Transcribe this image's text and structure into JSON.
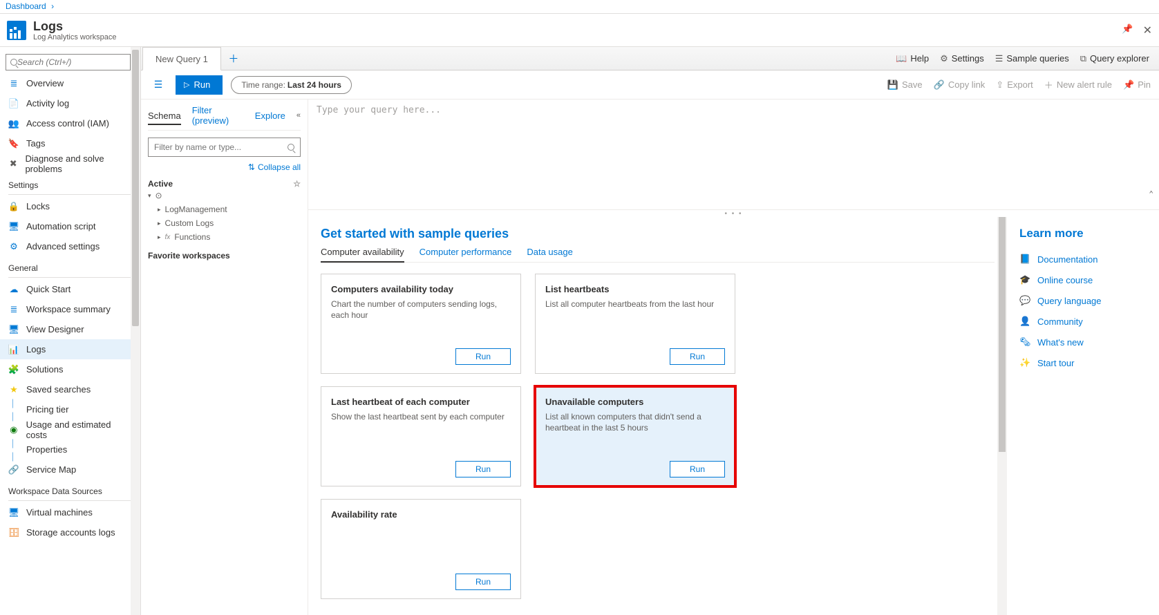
{
  "breadcrumb": {
    "root": "Dashboard"
  },
  "header": {
    "title": "Logs",
    "subtitle": "Log Analytics workspace"
  },
  "search": {
    "placeholder": "Search (Ctrl+/)"
  },
  "nav": {
    "top": [
      {
        "label": "Overview",
        "icon": "overview-icon"
      },
      {
        "label": "Activity log",
        "icon": "activity-icon"
      },
      {
        "label": "Access control (IAM)",
        "icon": "iam-icon"
      },
      {
        "label": "Tags",
        "icon": "tags-icon"
      },
      {
        "label": "Diagnose and solve problems",
        "icon": "diagnose-icon"
      }
    ],
    "sections": [
      {
        "title": "Settings",
        "items": [
          {
            "label": "Locks",
            "icon": "locks-icon"
          },
          {
            "label": "Automation script",
            "icon": "automation-icon"
          },
          {
            "label": "Advanced settings",
            "icon": "gear-icon"
          }
        ]
      },
      {
        "title": "General",
        "items": [
          {
            "label": "Quick Start",
            "icon": "quickstart-icon"
          },
          {
            "label": "Workspace summary",
            "icon": "summary-icon"
          },
          {
            "label": "View Designer",
            "icon": "viewdesigner-icon"
          },
          {
            "label": "Logs",
            "icon": "logs-icon",
            "active": true
          },
          {
            "label": "Solutions",
            "icon": "solutions-icon"
          },
          {
            "label": "Saved searches",
            "icon": "saved-icon"
          },
          {
            "label": "Pricing tier",
            "icon": "pricing-icon"
          },
          {
            "label": "Usage and estimated costs",
            "icon": "usage-icon"
          },
          {
            "label": "Properties",
            "icon": "properties-icon"
          },
          {
            "label": "Service Map",
            "icon": "servicemap-icon"
          }
        ]
      },
      {
        "title": "Workspace Data Sources",
        "items": [
          {
            "label": "Virtual machines",
            "icon": "vm-icon"
          },
          {
            "label": "Storage accounts logs",
            "icon": "storage-icon"
          }
        ]
      }
    ]
  },
  "tabs": {
    "query_tab": "New Query 1"
  },
  "tabs_right": [
    {
      "label": "Help",
      "icon": "book-icon"
    },
    {
      "label": "Settings",
      "icon": "gear-icon"
    },
    {
      "label": "Sample queries",
      "icon": "list-icon"
    },
    {
      "label": "Query explorer",
      "icon": "explorer-icon"
    }
  ],
  "toolbar": {
    "run": "Run",
    "time_label": "Time range:",
    "time_value": "Last 24 hours",
    "right": [
      {
        "label": "Save",
        "icon": "save-icon"
      },
      {
        "label": "Copy link",
        "icon": "link-icon"
      },
      {
        "label": "Export",
        "icon": "export-icon"
      },
      {
        "label": "New alert rule",
        "icon": "plus-icon"
      },
      {
        "label": "Pin",
        "icon": "pin-icon"
      }
    ]
  },
  "schema": {
    "tabs": {
      "schema": "Schema",
      "filter": "Filter (preview)",
      "explore": "Explore"
    },
    "filter_placeholder": "Filter by name or type...",
    "collapse_all": "Collapse all",
    "active_label": "Active",
    "tree": [
      {
        "label": "LogManagement"
      },
      {
        "label": "Custom Logs"
      },
      {
        "label": "Functions",
        "fx": true
      }
    ],
    "favorite": "Favorite workspaces"
  },
  "editor": {
    "placeholder": "Type your query here..."
  },
  "results": {
    "title": "Get started with sample queries",
    "tabs": [
      {
        "label": "Computer availability",
        "active": true
      },
      {
        "label": "Computer performance"
      },
      {
        "label": "Data usage"
      }
    ],
    "cards": [
      {
        "title": "Computers availability today",
        "desc": "Chart the number of computers sending logs, each hour",
        "run": "Run"
      },
      {
        "title": "List heartbeats",
        "desc": "List all computer heartbeats from the last hour",
        "run": "Run"
      },
      {
        "title": "Last heartbeat of each computer",
        "desc": "Show the last heartbeat sent by each computer",
        "run": "Run"
      },
      {
        "title": "Unavailable computers",
        "desc": "List all known computers that didn't send a heartbeat in the last 5 hours",
        "run": "Run",
        "highlight": true
      },
      {
        "title": "Availability rate",
        "desc": "",
        "run": "Run"
      }
    ]
  },
  "learn": {
    "title": "Learn more",
    "links": [
      {
        "label": "Documentation",
        "icon": "doc-icon"
      },
      {
        "label": "Online course",
        "icon": "course-icon"
      },
      {
        "label": "Query language",
        "icon": "query-icon"
      },
      {
        "label": "Community",
        "icon": "community-icon"
      },
      {
        "label": "What's new",
        "icon": "news-icon"
      },
      {
        "label": "Start tour",
        "icon": "tour-icon"
      }
    ]
  }
}
